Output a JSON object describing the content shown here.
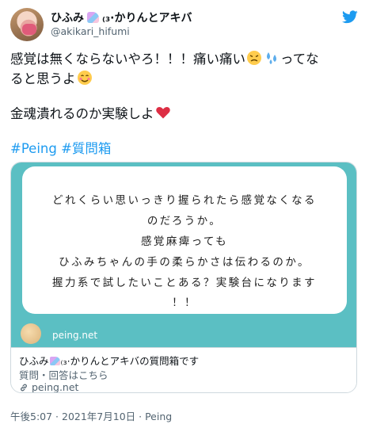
{
  "user": {
    "name_prefix": "ひふみ",
    "name_suffix": "₍₃·かりんとアキバ",
    "handle": "@akikari_hifumi"
  },
  "tweet": {
    "line1": "感覚は無くならないやろ！！！痛い痛い",
    "line1_tail": "ってな",
    "line2": "ると思うよ",
    "line3": "金魂潰れるのか実験しよ",
    "hashtags": "#Peing #質問箱",
    "emoji_icons": [
      "persevering-face-icon",
      "sweat-droplets-icon",
      "smiling-face-icon",
      "red-heart-icon"
    ]
  },
  "card": {
    "question_lines": [
      "どれくらい思いっきり握られたら感覚なくなる",
      "のだろうか。",
      "感覚麻痺っても",
      "ひふみちゃんの手の柔らかさは伝わるのか。",
      "握力系で試したいことある？実験台になります",
      "！！"
    ],
    "site_name": "peing.net",
    "title_prefix": "ひふみ",
    "title_suffix": "₍₃·かりんとアキバの質問箱です",
    "description": "質問・回答はこちら",
    "link": "peing.net",
    "background_color": "#5bbfc3"
  },
  "timestamp": "午後5:07 · 2021年7月10日 · Peing",
  "colors": {
    "accent": "#1d9bf0",
    "muted": "#536471"
  }
}
